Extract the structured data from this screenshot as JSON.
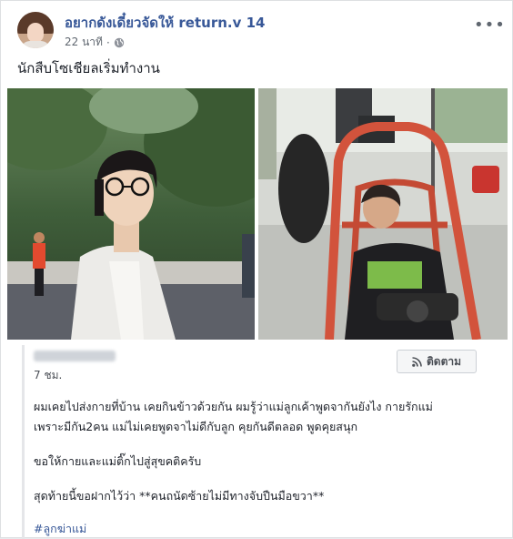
{
  "post": {
    "group_name": "อยากดังเดี๋ยวจัดให้ return.v 14",
    "time": "22 นาที",
    "more": "•••",
    "text": "นักสืบโซเชียลเริ่มทำงาน"
  },
  "shared": {
    "time": "7 ชม.",
    "follow_label": "ติดตาม",
    "lines": [
      "ผมเคยไปส่งกายที่บ้าน เคยกินข้าวด้วยกัน ผมรู้ว่าแม่ลูกเค้าพูดจากันยังไง กายรักแม่",
      "เพราะมีกัน2คน แม่ไม่เคยพูดจาไม่ดีกับลูก คุยกันดีตลอด พูดคุยสนุก",
      "ขอให้กายและแม่ติ๊กไปสู่สุขคติครับ",
      "สุดท้ายนี้ขอฝากไว้ว่า **คนถนัดซ้ายไม่มีทางจับปืนมือขวา**",
      "#ลูกฆ่าแม่"
    ]
  },
  "colors": {
    "link_blue": "#385898",
    "text": "#1d2129",
    "meta_gray": "#606770"
  }
}
